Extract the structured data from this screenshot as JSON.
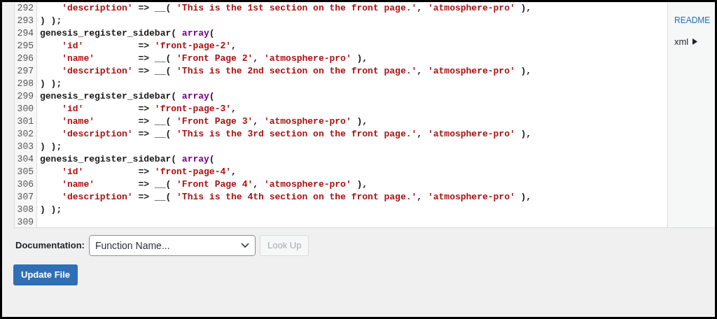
{
  "editor": {
    "lines": [
      {
        "number": "292",
        "tokens": [
          {
            "kind": "string",
            "text": "    'description'"
          },
          {
            "kind": "plain",
            "text": " => __( "
          },
          {
            "kind": "string",
            "text": "'This is the 1st section on the front page.'"
          },
          {
            "kind": "plain",
            "text": ", "
          },
          {
            "kind": "string",
            "text": "'atmosphere-pro'"
          },
          {
            "kind": "plain",
            "text": " ),"
          }
        ]
      },
      {
        "number": "293",
        "tokens": [
          {
            "kind": "plain",
            "text": ") );"
          }
        ]
      },
      {
        "number": "294",
        "tokens": [
          {
            "kind": "plain",
            "text": "genesis_register_sidebar( "
          },
          {
            "kind": "keyword",
            "text": "array"
          },
          {
            "kind": "plain",
            "text": "("
          }
        ]
      },
      {
        "number": "295",
        "tokens": [
          {
            "kind": "string",
            "text": "    'id'"
          },
          {
            "kind": "plain",
            "text": "          => "
          },
          {
            "kind": "string",
            "text": "'front-page-2'"
          },
          {
            "kind": "plain",
            "text": ","
          }
        ]
      },
      {
        "number": "296",
        "tokens": [
          {
            "kind": "string",
            "text": "    'name'"
          },
          {
            "kind": "plain",
            "text": "        => __( "
          },
          {
            "kind": "string",
            "text": "'Front Page 2'"
          },
          {
            "kind": "plain",
            "text": ", "
          },
          {
            "kind": "string",
            "text": "'atmosphere-pro'"
          },
          {
            "kind": "plain",
            "text": " ),"
          }
        ]
      },
      {
        "number": "297",
        "tokens": [
          {
            "kind": "string",
            "text": "    'description'"
          },
          {
            "kind": "plain",
            "text": " => __( "
          },
          {
            "kind": "string",
            "text": "'This is the 2nd section on the front page.'"
          },
          {
            "kind": "plain",
            "text": ", "
          },
          {
            "kind": "string",
            "text": "'atmosphere-pro'"
          },
          {
            "kind": "plain",
            "text": " ),"
          }
        ]
      },
      {
        "number": "298",
        "tokens": [
          {
            "kind": "plain",
            "text": ") );"
          }
        ]
      },
      {
        "number": "299",
        "tokens": [
          {
            "kind": "plain",
            "text": "genesis_register_sidebar( "
          },
          {
            "kind": "keyword",
            "text": "array"
          },
          {
            "kind": "plain",
            "text": "("
          }
        ]
      },
      {
        "number": "300",
        "tokens": [
          {
            "kind": "string",
            "text": "    'id'"
          },
          {
            "kind": "plain",
            "text": "          => "
          },
          {
            "kind": "string",
            "text": "'front-page-3'"
          },
          {
            "kind": "plain",
            "text": ","
          }
        ]
      },
      {
        "number": "301",
        "tokens": [
          {
            "kind": "string",
            "text": "    'name'"
          },
          {
            "kind": "plain",
            "text": "        => __( "
          },
          {
            "kind": "string",
            "text": "'Front Page 3'"
          },
          {
            "kind": "plain",
            "text": ", "
          },
          {
            "kind": "string",
            "text": "'atmosphere-pro'"
          },
          {
            "kind": "plain",
            "text": " ),"
          }
        ]
      },
      {
        "number": "302",
        "tokens": [
          {
            "kind": "string",
            "text": "    'description'"
          },
          {
            "kind": "plain",
            "text": " => __( "
          },
          {
            "kind": "string",
            "text": "'This is the 3rd section on the front page.'"
          },
          {
            "kind": "plain",
            "text": ", "
          },
          {
            "kind": "string",
            "text": "'atmosphere-pro'"
          },
          {
            "kind": "plain",
            "text": " ),"
          }
        ]
      },
      {
        "number": "303",
        "tokens": [
          {
            "kind": "plain",
            "text": ") );"
          }
        ]
      },
      {
        "number": "304",
        "tokens": [
          {
            "kind": "plain",
            "text": "genesis_register_sidebar( "
          },
          {
            "kind": "keyword",
            "text": "array"
          },
          {
            "kind": "plain",
            "text": "("
          }
        ]
      },
      {
        "number": "305",
        "tokens": [
          {
            "kind": "string",
            "text": "    'id'"
          },
          {
            "kind": "plain",
            "text": "          => "
          },
          {
            "kind": "string",
            "text": "'front-page-4'"
          },
          {
            "kind": "plain",
            "text": ","
          }
        ]
      },
      {
        "number": "306",
        "tokens": [
          {
            "kind": "string",
            "text": "    'name'"
          },
          {
            "kind": "plain",
            "text": "        => __( "
          },
          {
            "kind": "string",
            "text": "'Front Page 4'"
          },
          {
            "kind": "plain",
            "text": ", "
          },
          {
            "kind": "string",
            "text": "'atmosphere-pro'"
          },
          {
            "kind": "plain",
            "text": " ),"
          }
        ]
      },
      {
        "number": "307",
        "tokens": [
          {
            "kind": "string",
            "text": "    'description'"
          },
          {
            "kind": "plain",
            "text": " => __( "
          },
          {
            "kind": "string",
            "text": "'This is the 4th section on the front page.'"
          },
          {
            "kind": "plain",
            "text": ", "
          },
          {
            "kind": "string",
            "text": "'atmosphere-pro'"
          },
          {
            "kind": "plain",
            "text": " ),"
          }
        ]
      },
      {
        "number": "308",
        "tokens": [
          {
            "kind": "plain",
            "text": ") );"
          }
        ]
      },
      {
        "number": "309"
      }
    ]
  },
  "file_list": [
    {
      "kind": "link",
      "label": "README"
    },
    {
      "kind": "folder",
      "label": "xml",
      "expanded": false
    }
  ],
  "documentation": {
    "label": "Documentation:",
    "placeholder": "Function Name...",
    "lookup_button": {
      "label": "Look Up",
      "disabled": true
    }
  },
  "update_button": {
    "label": "Update File"
  }
}
